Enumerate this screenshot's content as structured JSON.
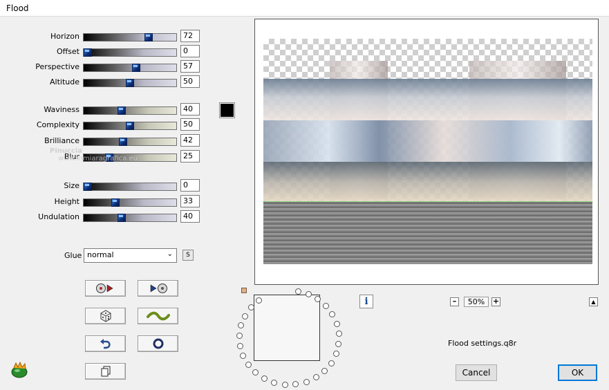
{
  "window": {
    "title": "Flood"
  },
  "params": [
    {
      "label": "Horizon",
      "value": "72"
    },
    {
      "label": "Offset",
      "value": "0"
    },
    {
      "label": "Perspective",
      "value": "57"
    },
    {
      "label": "Altitude",
      "value": "50"
    },
    {
      "label": "Waviness",
      "value": "40"
    },
    {
      "label": "Complexity",
      "value": "50"
    },
    {
      "label": "Brilliance",
      "value": "42"
    },
    {
      "label": "Blur",
      "value": "25"
    },
    {
      "label": "Size",
      "value": "0"
    },
    {
      "label": "Height",
      "value": "33"
    },
    {
      "label": "Undulation",
      "value": "40"
    }
  ],
  "color_swatch": {
    "color": "#000000"
  },
  "glue": {
    "label": "Glue",
    "value": "normal",
    "s_button": "S"
  },
  "preview": {
    "zoom": "50%"
  },
  "settings_file": "Flood settings.q8r",
  "buttons": {
    "cancel": "Cancel",
    "ok": "OK"
  },
  "watermark": {
    "line1": "Pinuccia",
    "line2": "www.inmiaragrafica.eu"
  }
}
